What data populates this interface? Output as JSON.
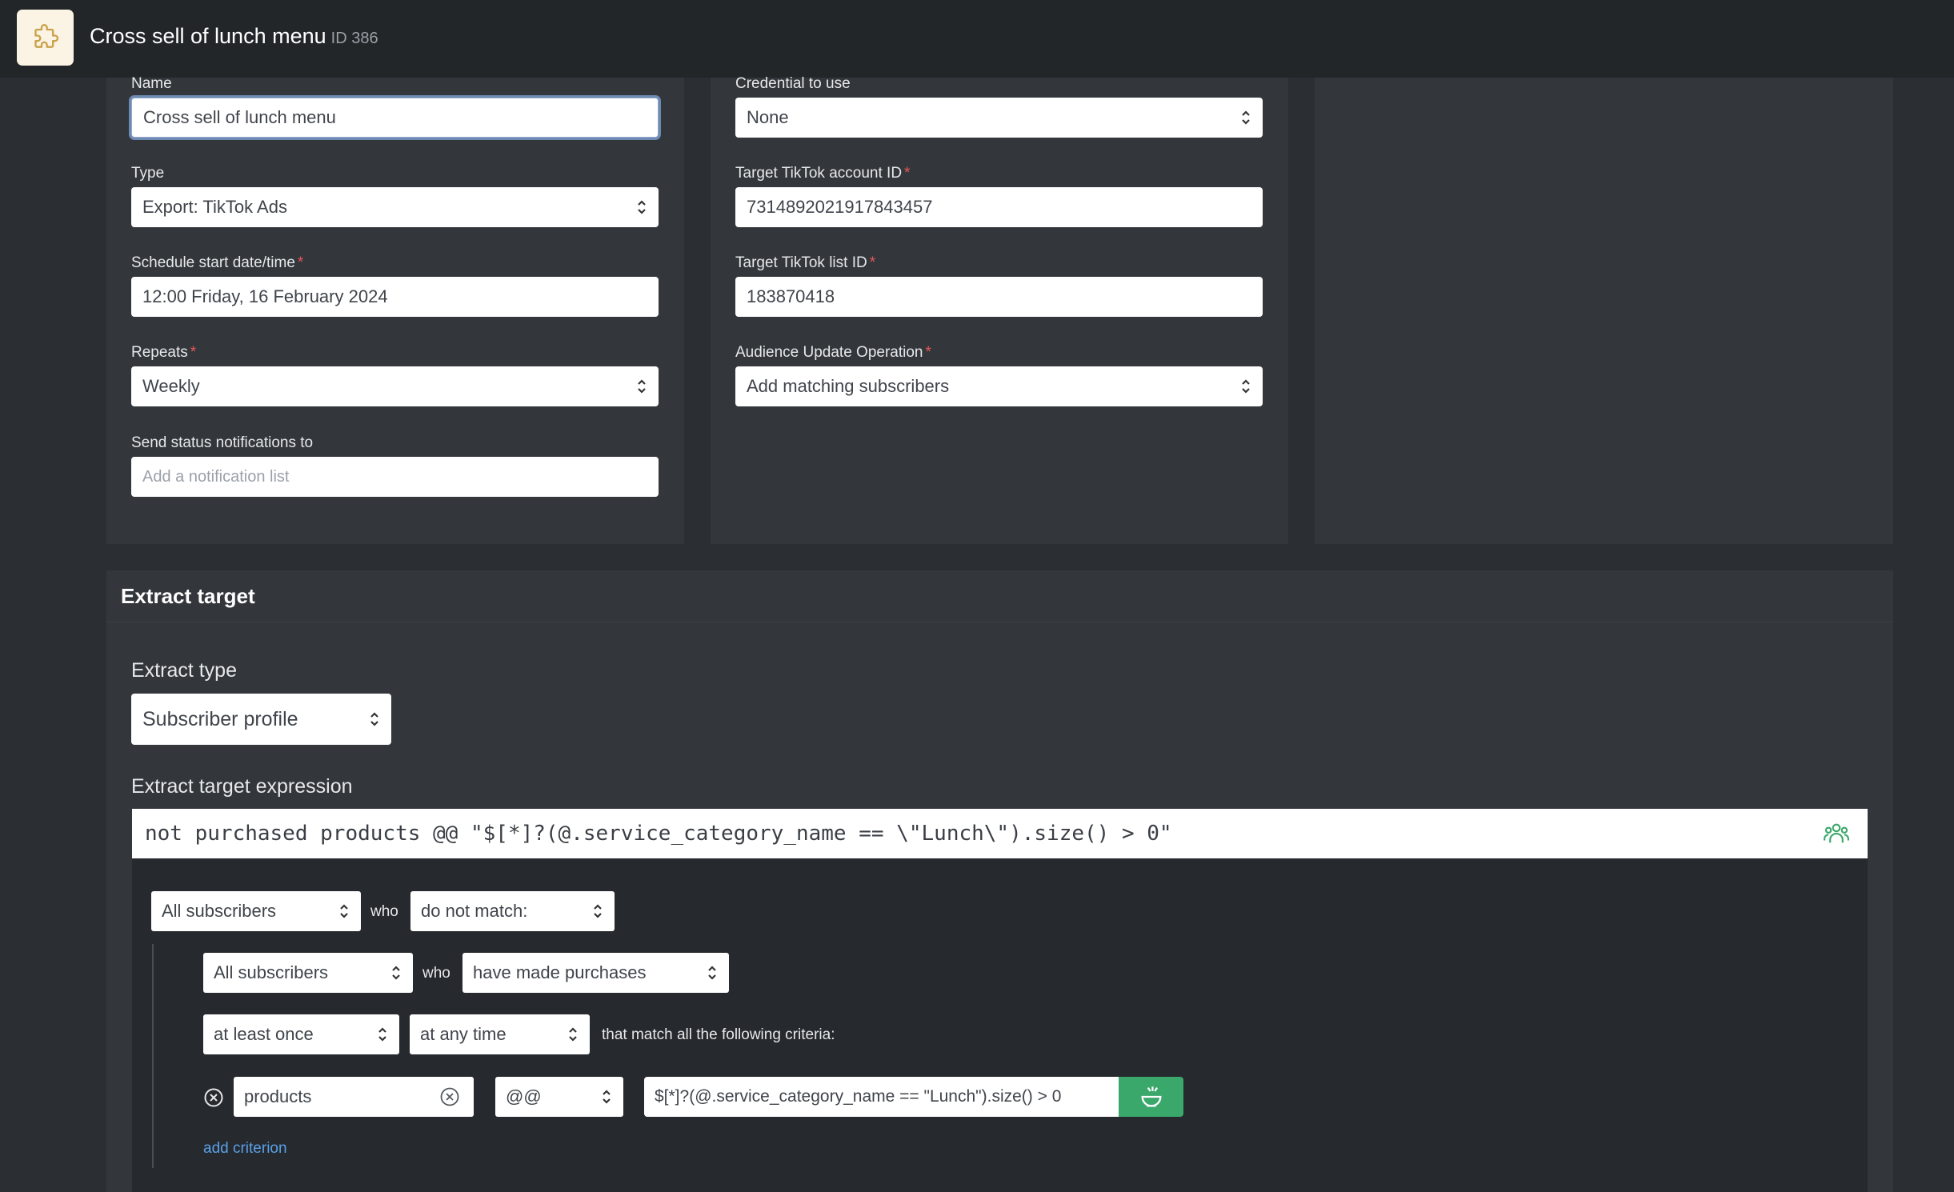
{
  "header": {
    "title": "Cross sell of lunch menu",
    "id_label": "ID 386"
  },
  "form_left": {
    "name_label": "Name",
    "name_value": "Cross sell of lunch menu",
    "type_label": "Type",
    "type_value": "Export: TikTok Ads",
    "schedule_label": "Schedule start date/time",
    "schedule_value": "12:00 Friday, 16 February 2024",
    "repeats_label": "Repeats",
    "repeats_value": "Weekly",
    "notify_label": "Send status notifications to",
    "notify_placeholder": "Add a notification list"
  },
  "form_right": {
    "credential_label": "Credential to use",
    "credential_value": "None",
    "account_label": "Target TikTok account ID",
    "account_value": "7314892021917843457",
    "list_label": "Target TikTok list ID",
    "list_value": "183870418",
    "operation_label": "Audience Update Operation",
    "operation_value": "Add matching subscribers"
  },
  "required_mark": "*",
  "extract": {
    "section_title": "Extract target",
    "type_label": "Extract type",
    "type_value": "Subscriber profile",
    "expression_label": "Extract target expression",
    "expression_value": "not purchased products @@ \"$[*]?(@.service_category_name == \\\"Lunch\\\").size() > 0\""
  },
  "builder": {
    "row1": {
      "scope": "All subscribers",
      "who": "who",
      "condition": "do not match:"
    },
    "row2": {
      "scope": "All subscribers",
      "who": "who",
      "condition": "have made purchases"
    },
    "row3": {
      "frequency": "at least once",
      "timeframe": "at any time",
      "suffix": "that match all the following criteria:"
    },
    "criterion": {
      "field": "products",
      "operator": "@@",
      "value": "$[*]?(@.service_category_name == \"Lunch\").size() > 0"
    },
    "add_criterion": "add criterion"
  }
}
